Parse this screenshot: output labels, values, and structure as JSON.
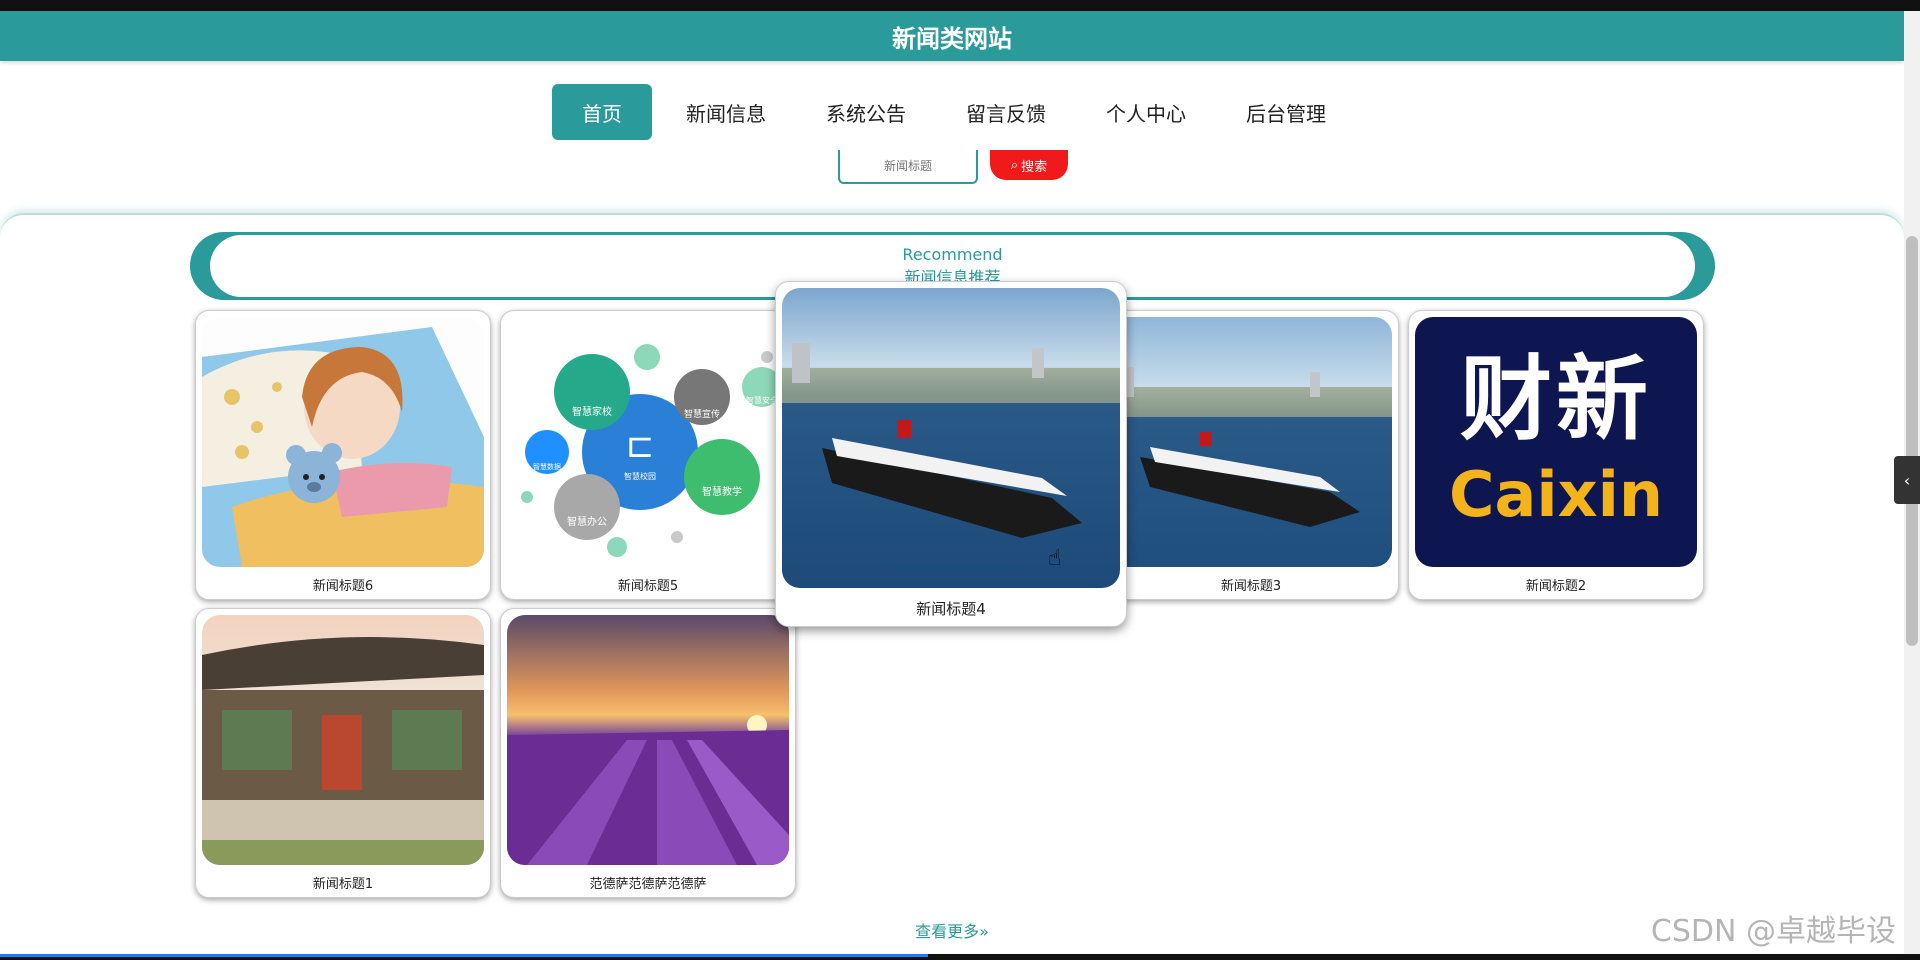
{
  "site": {
    "title": "新闻类网站"
  },
  "nav": {
    "items": [
      {
        "label": "首页",
        "active": true
      },
      {
        "label": "新闻信息"
      },
      {
        "label": "系统公告"
      },
      {
        "label": "留言反馈"
      },
      {
        "label": "个人中心"
      },
      {
        "label": "后台管理"
      }
    ]
  },
  "search": {
    "placeholder": "新闻标题",
    "button_label": "搜索",
    "button_icon": "search-icon"
  },
  "recommend": {
    "title_en": "Recommend",
    "title_cn": "新闻信息推荐"
  },
  "cards": [
    {
      "caption": "新闻标题6",
      "image": "cartoon-girl-sleeping"
    },
    {
      "caption": "新闻标题5",
      "image": "smart-campus-diagram"
    },
    {
      "caption": "新闻标题4",
      "image": "cruise-ship",
      "hovered": true
    },
    {
      "caption": "新闻标题3",
      "image": "cruise-ship"
    },
    {
      "caption": "新闻标题2",
      "image": "caixin-logo"
    },
    {
      "caption": "新闻标题1",
      "image": "old-chinese-house"
    },
    {
      "caption": "范德萨范德萨范德萨",
      "image": "lavender-field"
    }
  ],
  "caixin_logo": {
    "line1": "财新",
    "line2": "Caixin"
  },
  "smart_campus": {
    "center": "智慧校园",
    "labels": [
      "智慧家校",
      "智慧宣传",
      "智慧安全",
      "智慧数据",
      "智慧教学",
      "智慧办公"
    ]
  },
  "more": {
    "label": "查看更多»"
  },
  "watermark": "CSDN @卓越毕设",
  "colors": {
    "primary": "#2b9a9a",
    "search_button": "#f01a1a",
    "caixin_bg": "#0d1650",
    "caixin_text": "#f3b41b"
  }
}
